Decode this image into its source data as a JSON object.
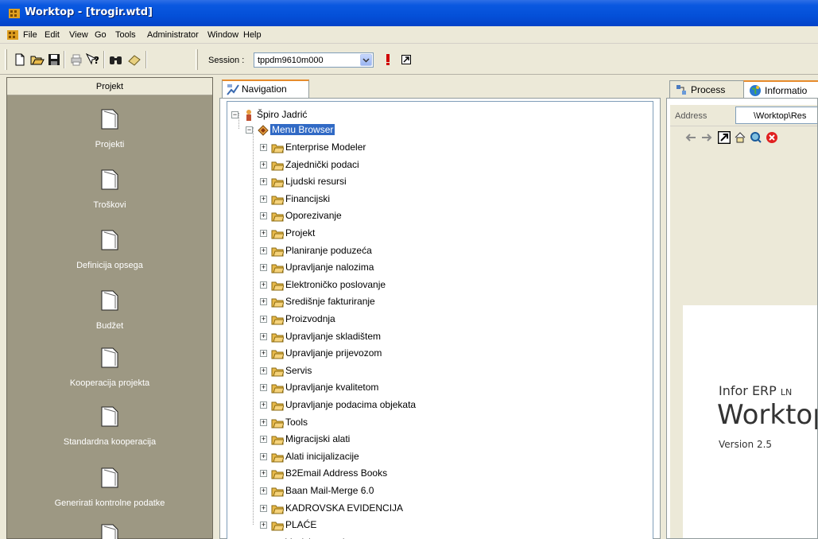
{
  "window": {
    "title": "Worktop - [trogir.wtd]"
  },
  "menubar": {
    "items": [
      "File",
      "Edit",
      "View",
      "Go",
      "Tools",
      "Administrator",
      "Window",
      "Help"
    ]
  },
  "toolbar": {
    "session_label": "Session :",
    "session_value": "tppdm9610m000",
    "buttons": [
      "new-icon",
      "open-icon",
      "save-icon",
      "print-icon",
      "help-icon",
      "find-icon",
      "eraser-icon",
      "warning-icon",
      "launch-icon"
    ]
  },
  "project_panel": {
    "header": "Projekt",
    "items": [
      {
        "label": "Projekti"
      },
      {
        "label": "Troškovi"
      },
      {
        "label": "Definicija opsega"
      },
      {
        "label": "Budžet"
      },
      {
        "label": "Kooperacija projekta"
      },
      {
        "label": "Standardna kooperacija"
      },
      {
        "label": "Generirati kontrolne podatke"
      },
      {
        "label": ""
      }
    ]
  },
  "navigation": {
    "tab_label": "Navigation",
    "root": "Špiro Jadrić",
    "browser": "Menu Browser",
    "modules": [
      "Enterprise Modeler",
      "Zajednički podaci",
      "Ljudski resursi",
      "Financijski",
      "Oporezivanje",
      "Projekt",
      "Planiranje poduzeća",
      "Upravljanje nalozima",
      "Elektroničko poslovanje",
      "Središnje fakturiranje",
      "Proizvodnja",
      "Upravljanje skladištem",
      "Upravljanje prijevozom",
      "Servis",
      "Upravljanje kvalitetom",
      "Upravljanje podacima objekata",
      "Tools",
      "Migracijski alati",
      "Alati inicijalizacije",
      "B2Email Address Books",
      "Baan Mail-Merge 6.0",
      "KADROVSKA EVIDENCIJA",
      "PLAĆE",
      "Vanjska trgovina"
    ]
  },
  "right_panel": {
    "tab_process": "Process",
    "tab_information": "Informatio",
    "address_label": "Address",
    "address_value": "\\Worktop\\Res",
    "splash_brand": "Infor ERP",
    "splash_brand_suffix": "LN",
    "splash_product": "Worktop",
    "splash_version": "Version 2.5"
  },
  "colors": {
    "titlebar": "#0450d8",
    "project_panel_bg": "#9d9883",
    "selection": "#316ac5",
    "folder": "#e8b94a"
  }
}
